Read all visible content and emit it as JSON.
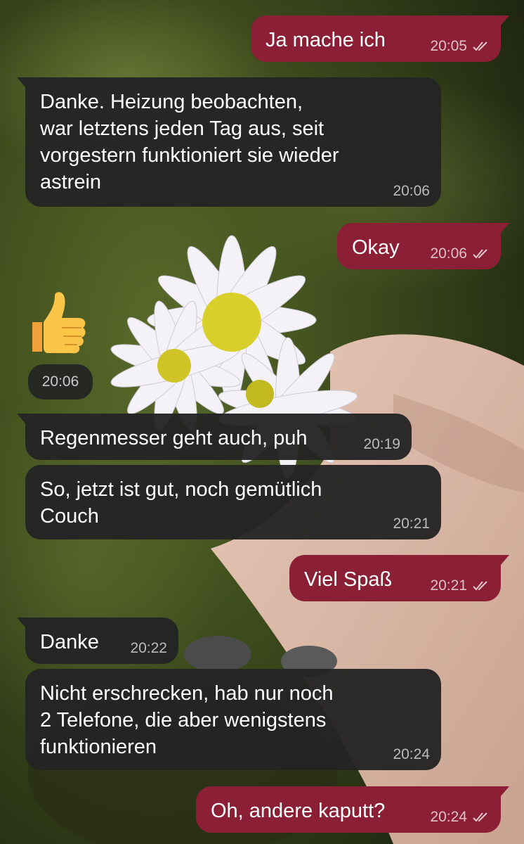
{
  "theme": {
    "incoming_bubble": "#242424",
    "outgoing_bubble": "#8a1f36",
    "text": "#ffffff"
  },
  "messages": [
    {
      "direction": "out",
      "text": "Ja mache ich",
      "time": "20:05",
      "status_icon": "double-check-icon"
    },
    {
      "direction": "in",
      "text": "Danke. Heizung beobachten,\nwar letztens jeden Tag aus, seit\nvorgestern funktioniert sie wieder\nastrein",
      "time": "20:06"
    },
    {
      "direction": "out",
      "text": "Okay",
      "time": "20:06",
      "status_icon": "double-check-icon"
    },
    {
      "direction": "in",
      "type": "emoji",
      "emoji_icon": "thumbs-up-emoji",
      "time": "20:06"
    },
    {
      "direction": "in",
      "text": "Regenmesser geht auch, puh",
      "time": "20:19"
    },
    {
      "direction": "in",
      "text": "So, jetzt ist gut, noch gemütlich\nCouch",
      "time": "20:21"
    },
    {
      "direction": "out",
      "text": "Viel Spaß",
      "time": "20:21",
      "status_icon": "double-check-icon"
    },
    {
      "direction": "in",
      "text": "Danke",
      "time": "20:22"
    },
    {
      "direction": "in",
      "text": "Nicht erschrecken, hab nur noch\n2 Telefone, die aber wenigstens\nfunktionieren",
      "time": "20:24"
    },
    {
      "direction": "out",
      "text": "Oh, andere kaputt?",
      "time": "20:24",
      "status_icon": "double-check-icon"
    }
  ]
}
